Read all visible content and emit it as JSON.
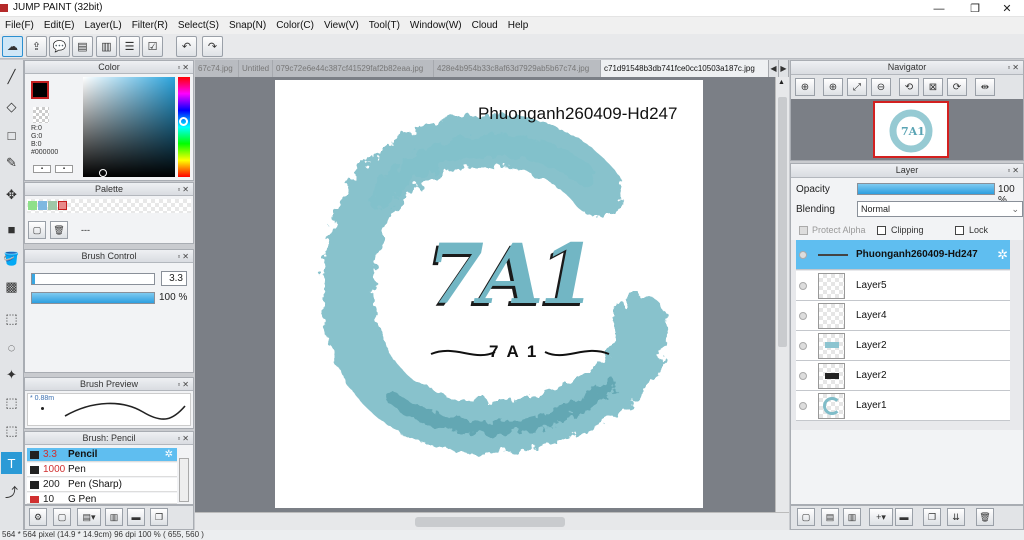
{
  "window": {
    "title": "JUMP PAINT (32bit)",
    "minimize": "—",
    "maximize": "❐",
    "close": "✕"
  },
  "menu": [
    "File(F)",
    "Edit(E)",
    "Layer(L)",
    "Filter(R)",
    "Select(S)",
    "Snap(N)",
    "Color(C)",
    "View(V)",
    "Tool(T)",
    "Window(W)",
    "Cloud",
    "Help"
  ],
  "color_panel": {
    "title": "Color",
    "r": "R:0",
    "g": "G:0",
    "b": "B:0",
    "hex": "#000000",
    "accent": "#000000"
  },
  "palette_panel": {
    "title": "Palette",
    "swatches": [
      "#8ee08a",
      "#7fb8e0",
      "#9fc7a7",
      "#e88a8a"
    ],
    "entry": "---"
  },
  "brush_control": {
    "title": "Brush Control",
    "size": "3.3",
    "opacity": "100 %",
    "opacity_value": 1.0
  },
  "brush_preview": {
    "title": "Brush Preview",
    "size_label": "* 0.88m"
  },
  "brush_list": {
    "title": "Brush: Pencil",
    "items": [
      {
        "size": "3.3",
        "name": "Pencil",
        "color": "#222222",
        "size_color": "#d03030"
      },
      {
        "size": "1000",
        "name": "Pen",
        "color": "#222222",
        "size_color": "#d03030"
      },
      {
        "size": "200",
        "name": "Pen (Sharp)",
        "color": "#222222",
        "size_color": "#222222"
      },
      {
        "size": "10",
        "name": "G Pen",
        "color": "#d03030",
        "size_color": "#222222"
      }
    ]
  },
  "tabs": [
    "67c74.jpg",
    "Untitled",
    "079c72e6e44c387cf41529faf2b82eaa.jpg",
    "428e4b954b33c8af63d7929ab5b67c74.jpg",
    "c71d91548b3db741fce0cc10503a187c.jpg"
  ],
  "artwork": {
    "watermark": "Phuonganh260409-Hd247",
    "logo_main": "7A1",
    "logo_sub": "7 A 1",
    "brush_color": "#5aaab8"
  },
  "navigator": {
    "title": "Navigator"
  },
  "layer_panel": {
    "title": "Layer",
    "opacity_label": "Opacity",
    "opacity": "100 %",
    "opacity_value": 1.0,
    "blending_label": "Blending",
    "blending": "Normal",
    "protect_alpha": "Protect Alpha",
    "clipping": "Clipping",
    "lock": "Lock",
    "layers": [
      "Phuonganh260409-Hd247",
      "Layer5",
      "Layer4",
      "Layer2",
      "Layer2",
      "Layer1"
    ]
  },
  "status": {
    "text": "564 * 564 pixel  (14.9 * 14.9cm)  96 dpi  100 %  ( 655, 560 )"
  }
}
